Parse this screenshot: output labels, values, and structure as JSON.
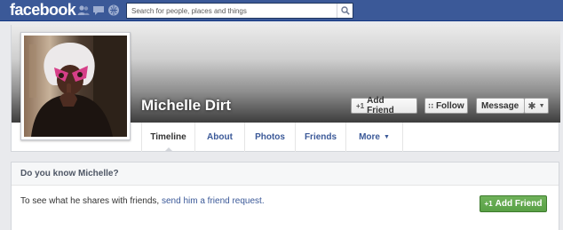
{
  "brand": {
    "logo_text": "facebook",
    "color": "#3b5998"
  },
  "topbar": {
    "jewels": [
      "friends-icon",
      "messages-icon",
      "notifications-icon"
    ],
    "search": {
      "placeholder": "Search for people, places and things",
      "value": ""
    }
  },
  "profile": {
    "name": "Michelle Dirt",
    "buttons": {
      "add_friend": "Add Friend",
      "follow": "Follow",
      "message": "Message"
    },
    "tabs": [
      {
        "label": "Timeline",
        "active": true
      },
      {
        "label": "About"
      },
      {
        "label": "Photos"
      },
      {
        "label": "Friends"
      },
      {
        "label": "More"
      }
    ]
  },
  "know_box": {
    "title": "Do you know Michelle?",
    "text_prefix": "To see what he shares with friends, ",
    "link_text": "send him a friend request.",
    "button": "Add Friend",
    "button_color": "#69a74e"
  }
}
